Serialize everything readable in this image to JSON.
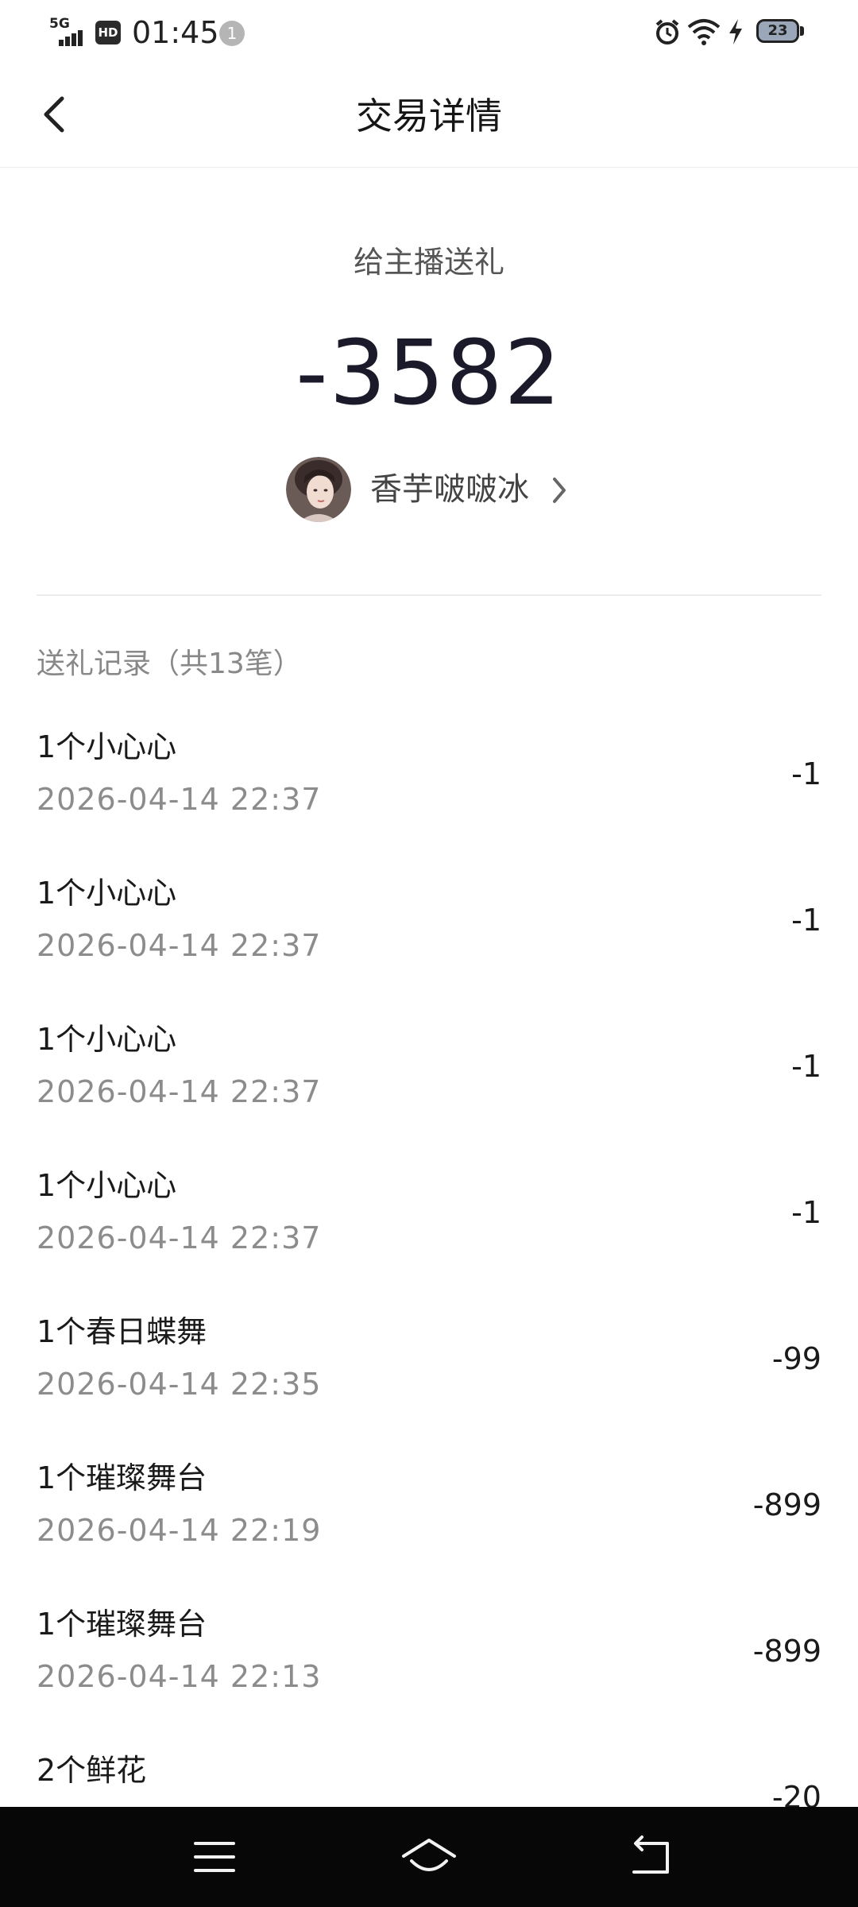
{
  "status_bar": {
    "network": "5G",
    "hd_label": "HD",
    "time": "01:45",
    "notification_count": "1",
    "battery_level": "23",
    "icons": [
      "signal-icon",
      "hd-icon",
      "alarm-icon",
      "wifi-icon",
      "charging-icon",
      "battery-icon"
    ]
  },
  "header": {
    "title": "交易详情",
    "back_icon": "chevron-left-icon"
  },
  "summary": {
    "type": "给主播送礼",
    "amount": "-3582",
    "recipient_name": "香芋啵啵冰",
    "recipient_chevron": "chevron-right-icon"
  },
  "records": {
    "header": "送礼记录（共13笔）",
    "items": [
      {
        "gift": "1个小心心",
        "time": "2026-04-14 22:37",
        "amount": "-1"
      },
      {
        "gift": "1个小心心",
        "time": "2026-04-14 22:37",
        "amount": "-1"
      },
      {
        "gift": "1个小心心",
        "time": "2026-04-14 22:37",
        "amount": "-1"
      },
      {
        "gift": "1个小心心",
        "time": "2026-04-14 22:37",
        "amount": "-1"
      },
      {
        "gift": "1个春日蝶舞",
        "time": "2026-04-14 22:35",
        "amount": "-99"
      },
      {
        "gift": "1个璀璨舞台",
        "time": "2026-04-14 22:19",
        "amount": "-899"
      },
      {
        "gift": "1个璀璨舞台",
        "time": "2026-04-14 22:13",
        "amount": "-899"
      },
      {
        "gift": "2个鲜花",
        "time": "",
        "amount": "-20"
      }
    ]
  },
  "nav_bar": {
    "icons": [
      "menu-icon",
      "home-icon",
      "back-icon"
    ]
  }
}
